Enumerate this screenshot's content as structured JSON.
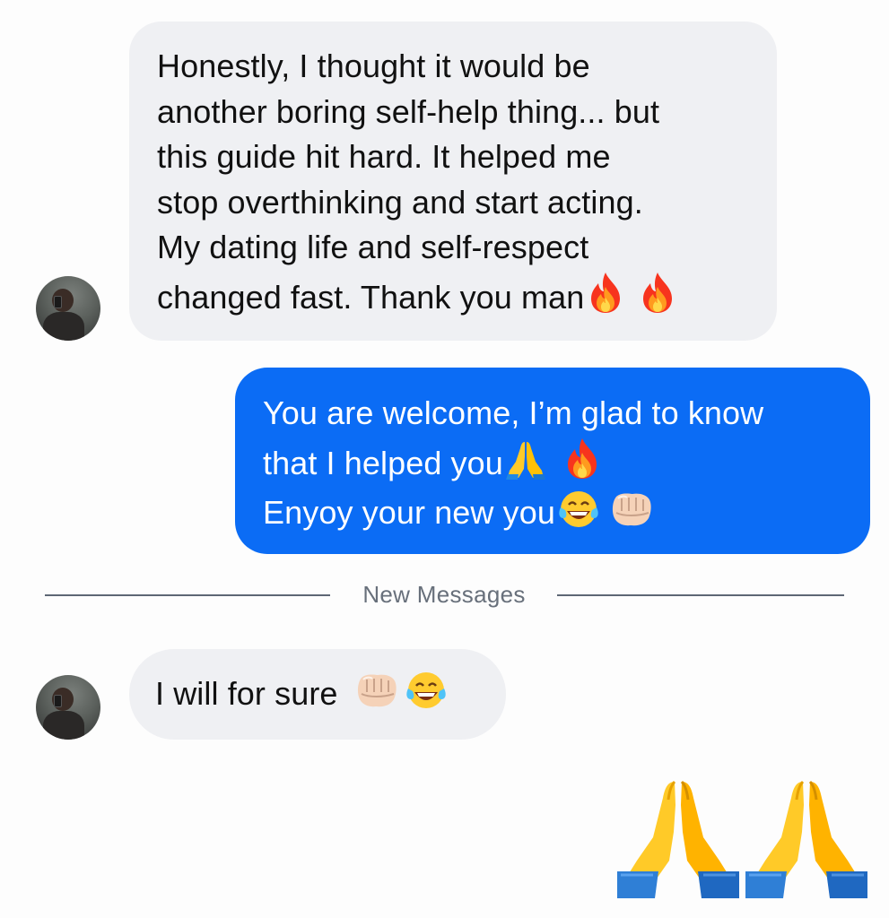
{
  "conversation": {
    "messages": [
      {
        "direction": "incoming",
        "lines": [
          "Honestly, I thought it would be",
          "another boring self-help thing... but",
          "this guide hit hard. It helped me",
          "stop overthinking and start acting.",
          "My dating life and self-respect",
          "changed fast. Thank you man"
        ],
        "emojis": [
          "fire-icon",
          "fire-icon"
        ]
      },
      {
        "direction": "outgoing",
        "lines": [
          "You are welcome, I’m glad to know",
          "that I helped you",
          "Enyoy your new you"
        ],
        "emojis": [
          "praying-hands-icon",
          "fire-icon",
          "tears-of-joy-icon",
          "fist-bump-icon"
        ]
      },
      {
        "direction": "incoming",
        "lines": [
          "I will for sure"
        ],
        "emojis": [
          "fist-bump-icon",
          "tears-of-joy-icon"
        ]
      },
      {
        "direction": "outgoing",
        "lines": [],
        "emojis": [
          "praying-hands-icon",
          "praying-hands-icon"
        ]
      }
    ],
    "divider_label": "New Messages"
  },
  "colors": {
    "incoming_bubble": "#eff0f3",
    "outgoing_bubble": "#0b6cf5",
    "divider_line": "#5e6775",
    "divider_text": "#68707b",
    "background": "#fdfdfd"
  }
}
